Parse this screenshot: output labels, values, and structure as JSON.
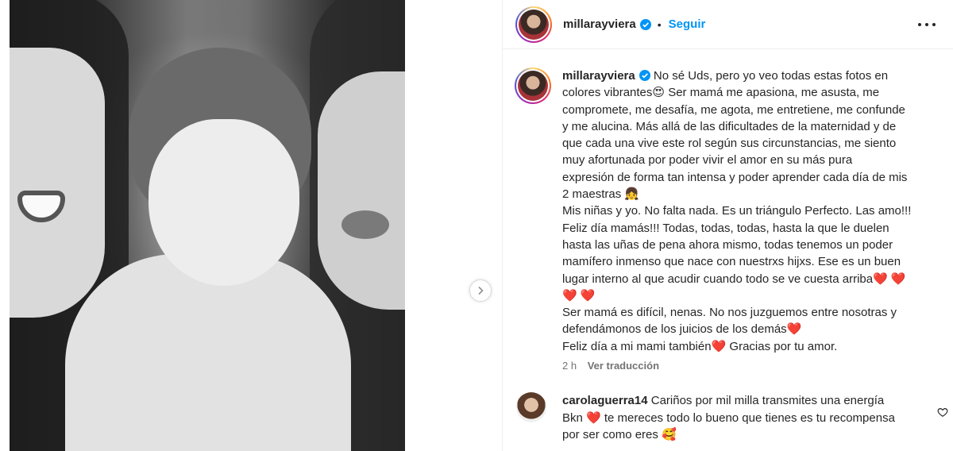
{
  "post": {
    "username": "millarayviera",
    "follow_label": "Seguir",
    "separator": "•"
  },
  "caption": {
    "username": "millarayviera",
    "lines": [
      " No sé Uds, pero yo veo todas estas fotos en",
      "colores vibrantes😍 Ser mamá me apasiona, me asusta, me",
      "compromete, me desafía, me agota, me entretiene, me confunde",
      "y me alucina. Más allá de las dificultades de la maternidad y de",
      "que cada una vive este rol según sus circunstancias, me siento",
      "muy afortunada por poder vivir el amor en su más pura",
      "expresión de forma tan intensa y poder aprender cada día de mis",
      "2 maestras 👧",
      "Mis niñas y yo. No falta nada. Es un triángulo Perfecto. Las amo!!!",
      "Feliz día mamás!!! Todas, todas, todas, hasta la que le duelen",
      "hasta las uñas de pena ahora mismo, todas tenemos un poder",
      "mamífero inmenso que nace con nuestrxs hijxs. Ese es un buen",
      "lugar interno al que acudir cuando todo se ve cuesta arriba❤️ ❤️",
      "❤️ ❤️",
      "Ser mamá es difícil, nenas. No nos juzguemos entre nosotras y",
      "defendámonos de los juicios de los demás❤️",
      "Feliz día a mi mami también❤️  Gracias por tu amor."
    ],
    "time": "2 h",
    "translate_label": "Ver traducción"
  },
  "comment": {
    "username": "carolaguerra14",
    "lines": [
      " Cariños por mil milla transmites una energía",
      "Bkn ❤️ te mereces todo lo bueno que tienes es tu recompensa",
      "por ser como eres 🥰"
    ]
  },
  "icons": {
    "verified": "verified-badge-icon",
    "more": "more-options-icon",
    "next": "chevron-right-icon",
    "like": "heart-outline-icon"
  },
  "colors": {
    "accent": "#0095f6",
    "text": "#262626",
    "muted": "#737373"
  }
}
